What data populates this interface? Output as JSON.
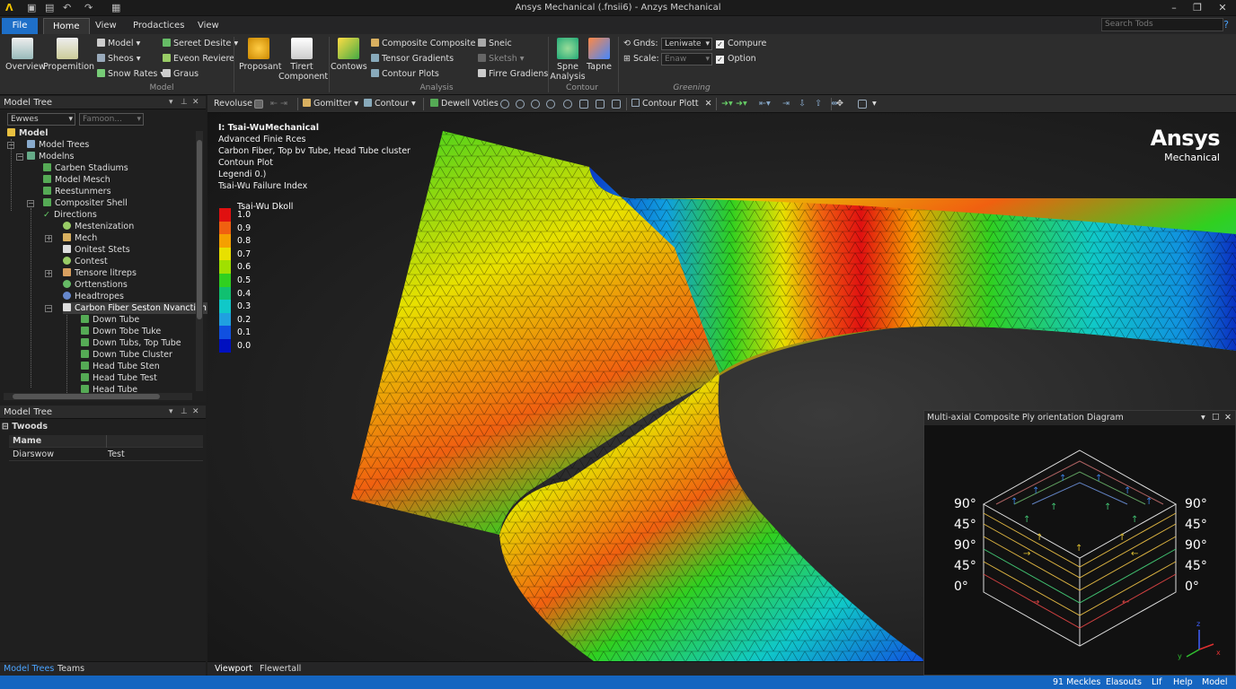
{
  "window": {
    "title": "Ansys Mechanical (.fnsii6) - Anzys Mechanical"
  },
  "quick_access": {
    "logo": "Λ",
    "icons": [
      "folder-icon",
      "save-icon",
      "undo-icon",
      "redo-icon",
      "print-icon"
    ]
  },
  "ribbon_tabs": [
    {
      "label": "File"
    },
    {
      "label": "Home"
    },
    {
      "label": "View"
    },
    {
      "label": "Prodactices"
    },
    {
      "label": "View"
    }
  ],
  "search": {
    "placeholder": "Search Tods"
  },
  "ribbon": {
    "model_group": {
      "label": "Model",
      "overview": "Overview",
      "propemition": "Propemition",
      "model": "Model",
      "sheos": "Sheos",
      "snow_rates": "Snow Rates",
      "sereet_desite": "Sereet Desite",
      "eveon_reviere": "Eveon Reviere",
      "graus": "Graus"
    },
    "component_group": {
      "proposant": "Proposant",
      "tirert_1": "Tirert",
      "tirert_2": "Component"
    },
    "analysis_group": {
      "label": "Analysis",
      "contows": "Contows",
      "composite": "Composite Composite",
      "tensor_gradients": "Tensor Gradients",
      "contour_plots": "Contour Plots",
      "sneic": "Sneic",
      "sketsh": "Sketsh",
      "firre_gradiens": "Firre Gradiens"
    },
    "contour_group": {
      "label": "Contour",
      "spne_1": "Spne",
      "spne_2": "Analysis",
      "tapne": "Tapne"
    },
    "greening_group": {
      "label": "Greening",
      "gnds_label": "Gnds:",
      "gnds_value": "Leniwate",
      "scale_label": "Scale:",
      "scale_value": "Enaw",
      "compure": "Compure",
      "option": "Option"
    }
  },
  "model_tree": {
    "title": "Model Tree",
    "filter1": "Ewwes",
    "filter2": "Famoon...",
    "items": [
      {
        "label": "Model"
      },
      {
        "label": "Model Trees"
      },
      {
        "label": "Modelns"
      },
      {
        "label": "Carben Stadiums"
      },
      {
        "label": "Model Mesch"
      },
      {
        "label": "Reestunmers"
      },
      {
        "label": "Compositer Shell"
      },
      {
        "label": "Directions"
      },
      {
        "label": "Mestenization"
      },
      {
        "label": "Mech"
      },
      {
        "label": "Onitest Stets"
      },
      {
        "label": "Contest"
      },
      {
        "label": "Tensore litreps"
      },
      {
        "label": "Orttenstions"
      },
      {
        "label": "Headtropes"
      },
      {
        "label": "Carbon Fiber Seston Nvanction"
      },
      {
        "label": "Down Tube"
      },
      {
        "label": "Down Tobe Tuke"
      },
      {
        "label": "Down Tubs, Top Tube"
      },
      {
        "label": "Down Tube Cluster"
      },
      {
        "label": "Head Tube Sten"
      },
      {
        "label": "Head Tube Test"
      },
      {
        "label": "Head Tube"
      }
    ]
  },
  "details": {
    "title": "Model Tree",
    "section": "Twoods",
    "header_name": "Mame",
    "rows": [
      {
        "name": "Diarswow",
        "value": "Test"
      }
    ]
  },
  "left_bottom_tabs": [
    "Model Trees",
    "Teams"
  ],
  "viewport_toolbar": {
    "revoluse": "Revoluse",
    "gomitter": "Gomitter",
    "contour": "Contour",
    "dewell": "Dewell Voties",
    "contour_tab": "Contour Plott"
  },
  "viewport_info": {
    "line1": "I: Tsai-WuMechanical",
    "line2": "Advanced Finie Rces",
    "line3": "Carbon Fiber, Top bv Tube, Head Tube cluster",
    "line4": "Contoun Plot",
    "line5": "Legendi 0.)",
    "line6": "Tsai-Wu Failure Index"
  },
  "legend": {
    "title": "Tsai-Wu Dkoll",
    "values": [
      "1.0",
      "0.9",
      "0.8",
      "0.7",
      "0.6",
      "0.5",
      "0.4",
      "0.3",
      "0.2",
      "0.1",
      "0.0"
    ],
    "colors": [
      "#e01010",
      "#f06010",
      "#f5a000",
      "#e8e000",
      "#a0e000",
      "#30d020",
      "#10c070",
      "#10c8c8",
      "#20a0e0",
      "#1050e0",
      "#0010c0"
    ]
  },
  "brand": {
    "name": "Ansys",
    "sub": "Mechanical"
  },
  "ply_diagram": {
    "title": "Multi-axial Composite Ply orientation Diagram",
    "left_labels": [
      "90°",
      "45°",
      "90°",
      "45°",
      "0°"
    ],
    "right_labels": [
      "90°",
      "45°",
      "90°",
      "45°",
      "0°"
    ],
    "axes": [
      "x",
      "y",
      "z"
    ]
  },
  "viewport_tabs": [
    "Viewport",
    "Flewertall"
  ],
  "status": [
    "91 Meckles",
    "Elasouts",
    "LIf",
    "Help",
    "Model"
  ]
}
